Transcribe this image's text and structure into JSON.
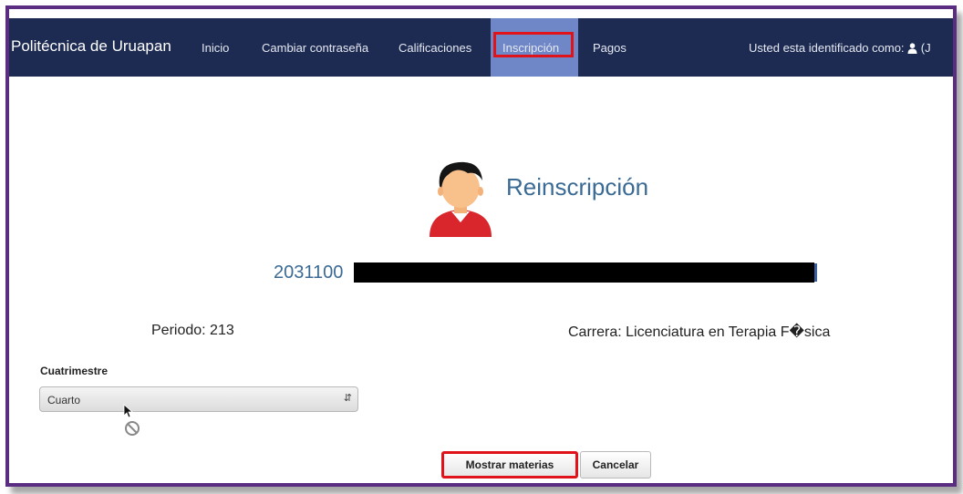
{
  "navbar": {
    "brand": "Politécnica de Uruapan",
    "items": [
      {
        "label": "Inicio"
      },
      {
        "label": "Cambiar contraseña"
      },
      {
        "label": "Calificaciones"
      },
      {
        "label": "Inscripción",
        "active": true
      },
      {
        "label": "Pagos"
      }
    ],
    "user_text": "Usted esta identificado como:",
    "user_suffix": "(J",
    "user_icon": "user-icon"
  },
  "page": {
    "title": "Reinscripción",
    "avatar_icon": "student-avatar-icon",
    "student_id": "2031100"
  },
  "info": {
    "periodo": "Periodo: 213",
    "carrera": "Carrera: Licenciatura en Terapia F�sica"
  },
  "form": {
    "cuatrimestre_label": "Cuatrimestre",
    "cuatrimestre_value": "Cuarto"
  },
  "buttons": {
    "show": "Mostrar materias",
    "cancel": "Cancelar"
  },
  "colors": {
    "navbar": "#1d2b52",
    "active_tab": "#6f86c7",
    "highlight": "#e0131a",
    "frame": "#5a2d82",
    "title": "#3b6a94"
  }
}
